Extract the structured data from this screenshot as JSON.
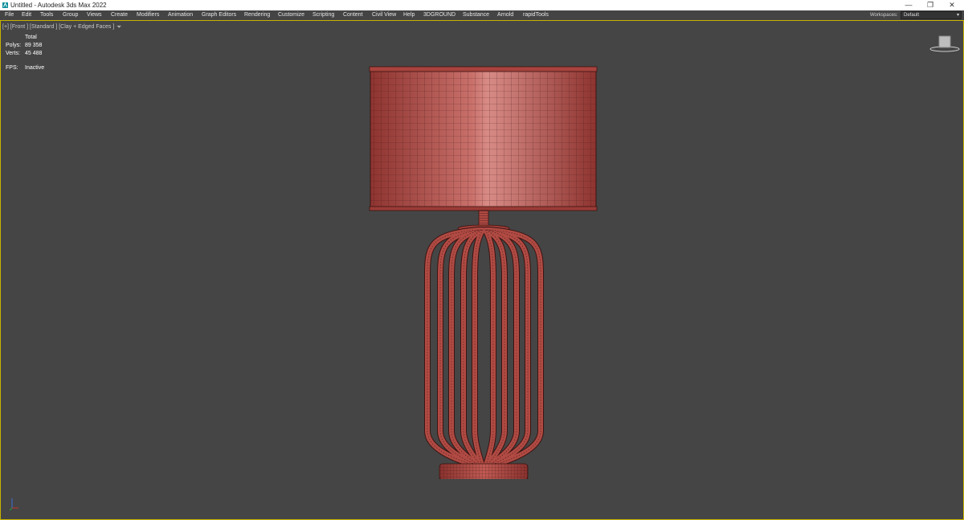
{
  "window": {
    "title": "Untitled - Autodesk 3ds Max 2022",
    "controls": {
      "minimize": "—",
      "restore": "❐",
      "close": "✕"
    }
  },
  "menubar": {
    "items": [
      "File",
      "Edit",
      "Tools",
      "Group",
      "Views",
      "Create",
      "Modifiers",
      "Animation",
      "Graph Editors",
      "Rendering",
      "Customize",
      "Scripting",
      "Content",
      "Civil View",
      "Help",
      "3DGROUND",
      "Substance",
      "Arnold",
      "rapidTools"
    ],
    "workspaces_label": "Workspaces:",
    "workspace_value": "Default"
  },
  "viewport": {
    "label": "[+] [Front ] [Standard ] [Clay + Edged Faces ]",
    "stats": {
      "header": "Total",
      "polys_label": "Polys:",
      "polys_value": "89 358",
      "verts_label": "Verts:",
      "verts_value": "45 488",
      "fps_label": "FPS:",
      "fps_value": "Inactive"
    }
  },
  "colors": {
    "accent_border": "#c7b300",
    "viewport_bg": "#454545",
    "model_red": "#b04a43",
    "wire": "#3a1412"
  },
  "icons": {
    "app": "3ds-max-icon",
    "filter": "funnel-icon",
    "viewcube": "viewcube-icon",
    "axis": "axis-tripod-icon"
  }
}
